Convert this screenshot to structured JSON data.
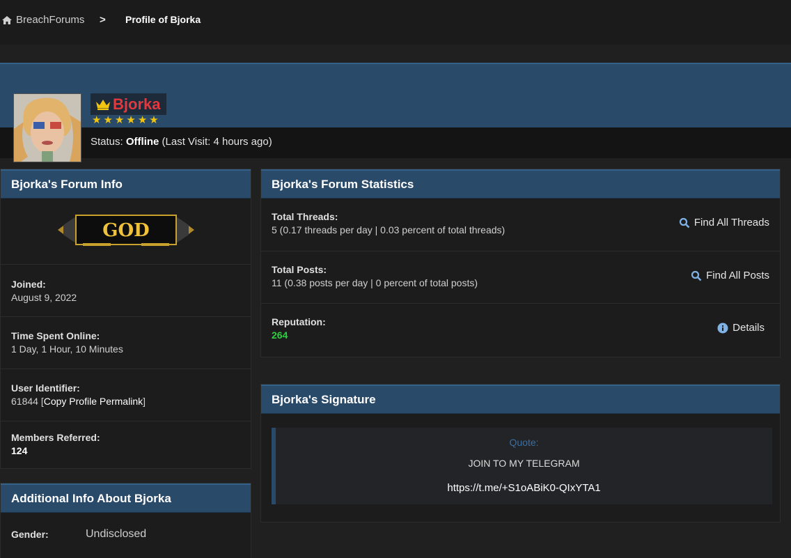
{
  "breadcrumb": {
    "home_label": "BreachForums",
    "separator": ">",
    "current": "Profile of Bjorka",
    "home_icon": "home-icon"
  },
  "profile": {
    "username": "Bjorka",
    "crown_icon": "crown-icon",
    "stars": 6,
    "status_label": "Status:",
    "status_value": "Offline",
    "status_detail": "(Last Visit: 4 hours ago)",
    "name_color": "#e0393e"
  },
  "forum_info": {
    "title": "Bjorka's Forum Info",
    "rank_badge_text": "GOD",
    "joined_label": "Joined:",
    "joined_value": "August 9, 2022",
    "time_online_label": "Time Spent Online:",
    "time_online_value": "1 Day, 1 Hour, 10 Minutes",
    "user_id_label": "User Identifier:",
    "user_id_value": "61844",
    "permalink_label": "Copy Profile Permalink",
    "referred_label": "Members Referred:",
    "referred_value": "124"
  },
  "additional_info": {
    "title": "Additional Info About Bjorka",
    "gender_label": "Gender:",
    "gender_value": "Undisclosed"
  },
  "statistics": {
    "title": "Bjorka's Forum Statistics",
    "threads_label": "Total Threads:",
    "threads_value": "5 (0.17 threads per day | 0.03 percent of total threads)",
    "threads_action": "Find All Threads",
    "posts_label": "Total Posts:",
    "posts_value": "11 (0.38 posts per day | 0 percent of total posts)",
    "posts_action": "Find All Posts",
    "reputation_label": "Reputation:",
    "reputation_value": "264",
    "reputation_action": "Details",
    "reputation_color": "#2ecc40"
  },
  "signature": {
    "title": "Bjorka's Signature",
    "quote_title": "Quote:",
    "line1": "JOIN TO MY TELEGRAM",
    "line2": "https://t.me/+S1oABiK0-QIxYTA1"
  }
}
